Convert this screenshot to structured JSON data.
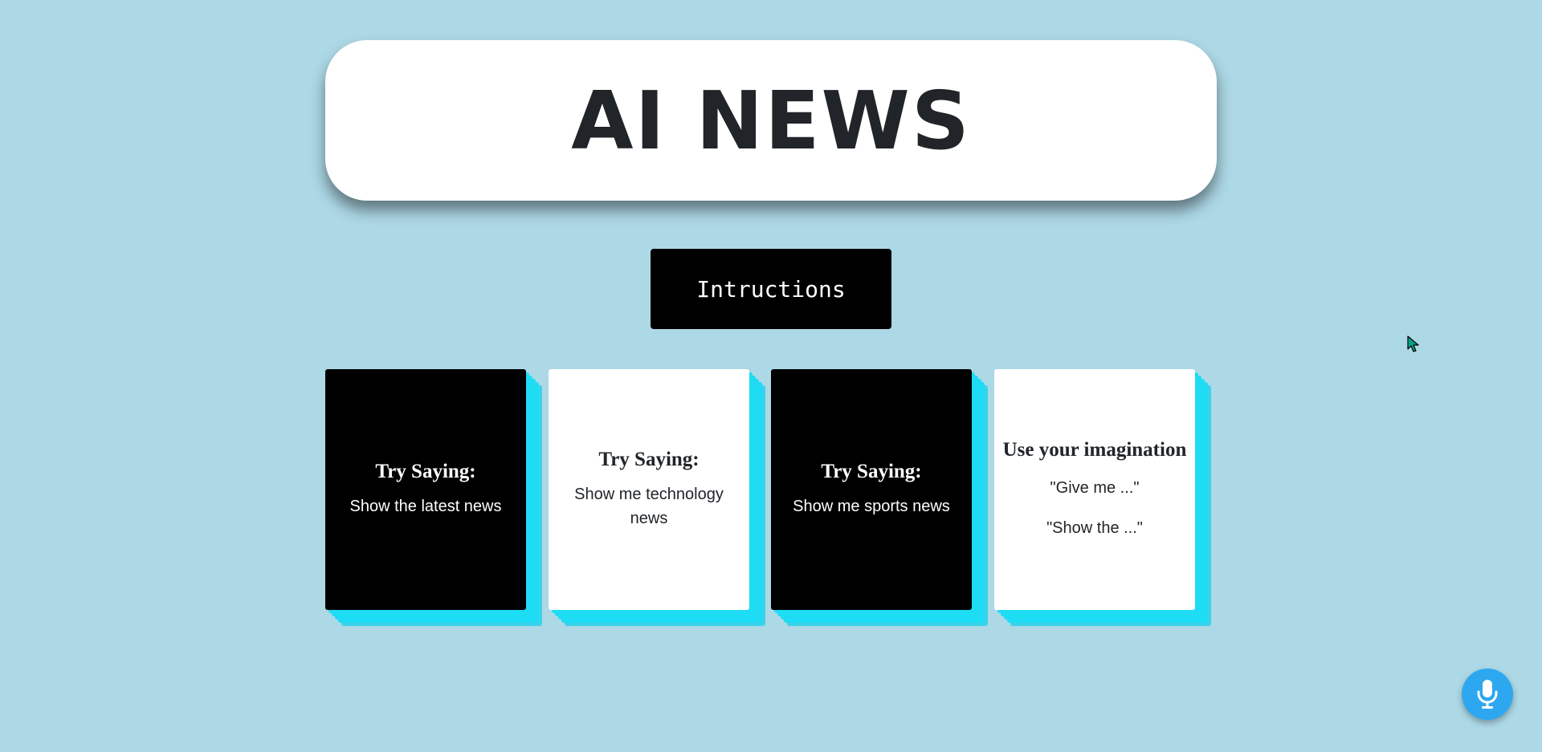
{
  "header": {
    "title": "AI NEWS"
  },
  "instructions_button": {
    "label": "Intructions"
  },
  "cards": [
    {
      "heading": "Try Saying:",
      "lines": [
        "Show the latest news"
      ]
    },
    {
      "heading": "Try Saying:",
      "lines": [
        "Show me technology news"
      ]
    },
    {
      "heading": "Try Saying:",
      "lines": [
        "Show me sports news"
      ]
    },
    {
      "heading": "Use your imagination",
      "lines": [
        "\"Give me ...\"",
        "\"Show the ...\""
      ]
    }
  ],
  "icons": {
    "mic": "microphone-icon",
    "cursor": "mouse-pointer-icon"
  },
  "colors": {
    "background": "#add8e6",
    "card_shadow": "#1fdcf5",
    "mic_button": "#2da8f0",
    "dark_card": "#000000",
    "light_card": "#ffffff"
  }
}
